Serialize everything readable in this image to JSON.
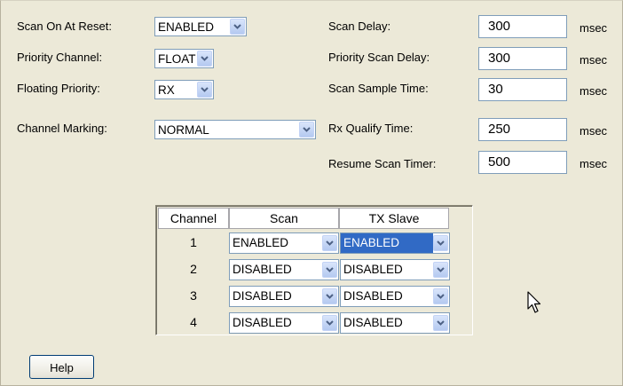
{
  "settings": {
    "scan_on_reset": {
      "label": "Scan On At Reset:",
      "value": "ENABLED"
    },
    "priority_channel": {
      "label": "Priority Channel:",
      "value": "FLOAT"
    },
    "floating_priority": {
      "label": "Floating Priority:",
      "value": "RX"
    },
    "channel_marking": {
      "label": "Channel Marking:",
      "value": "NORMAL"
    }
  },
  "timers": {
    "scan_delay": {
      "label": "Scan Delay:",
      "value": "300",
      "unit": "msec"
    },
    "priority_scan_delay": {
      "label": "Priority Scan Delay:",
      "value": "300",
      "unit": "msec"
    },
    "scan_sample_time": {
      "label": "Scan Sample Time:",
      "value": "30",
      "unit": "msec"
    },
    "rx_qualify_time": {
      "label": "Rx Qualify Time:",
      "value": "250",
      "unit": "msec"
    },
    "resume_scan_timer": {
      "label": "Resume Scan Timer:",
      "value": "500",
      "unit": "msec"
    }
  },
  "table": {
    "headers": [
      "Channel",
      "Scan",
      "TX Slave"
    ],
    "rows": [
      {
        "channel": "1",
        "scan": "ENABLED",
        "tx_slave": "ENABLED"
      },
      {
        "channel": "2",
        "scan": "DISABLED",
        "tx_slave": "DISABLED"
      },
      {
        "channel": "3",
        "scan": "DISABLED",
        "tx_slave": "DISABLED"
      },
      {
        "channel": "4",
        "scan": "DISABLED",
        "tx_slave": "DISABLED"
      }
    ]
  },
  "help_label": "Help",
  "colors": {
    "selection": "#316ac5",
    "background": "#ece9d8",
    "border": "#7f9db9"
  },
  "icons": [
    "chevron-down-icon",
    "mouse-pointer-icon"
  ]
}
